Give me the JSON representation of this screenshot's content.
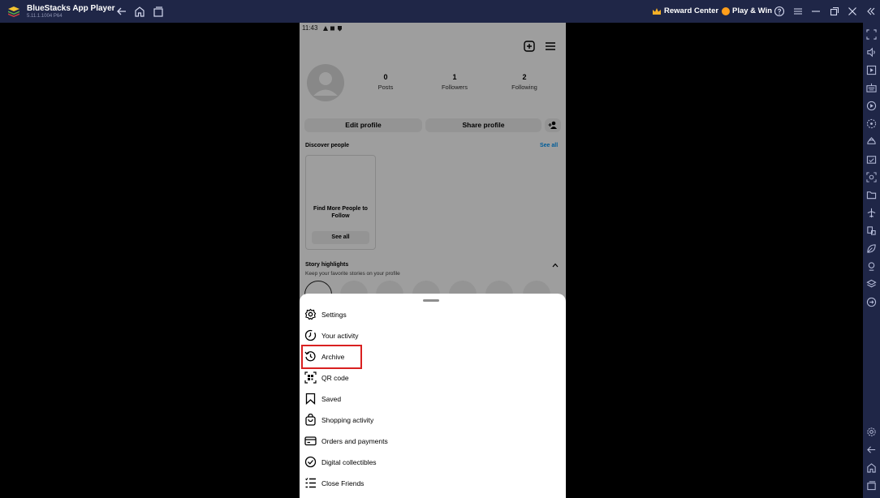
{
  "titlebar": {
    "app_name": "BlueStacks App Player",
    "app_version": "5.11.1.1004 P64",
    "reward_center": "Reward Center",
    "play_win": "Play & Win",
    "accent_color": "#1f2647"
  },
  "phone": {
    "status_time": "11:43",
    "profile": {
      "posts_count": "0",
      "posts_label": "Posts",
      "followers_count": "1",
      "followers_label": "Followers",
      "following_count": "2",
      "following_label": "Following",
      "edit_profile": "Edit profile",
      "share_profile": "Share profile"
    },
    "discover": {
      "title": "Discover people",
      "see_all": "See all",
      "card_text": "Find More People to Follow",
      "card_button": "See all"
    },
    "highlights": {
      "title": "Story highlights",
      "subtitle": "Keep your favorite stories on your profile"
    }
  },
  "menu": {
    "items": [
      {
        "label": "Settings",
        "icon": "settings-icon"
      },
      {
        "label": "Your activity",
        "icon": "activity-icon"
      },
      {
        "label": "Archive",
        "icon": "archive-icon"
      },
      {
        "label": "QR code",
        "icon": "qr-code-icon"
      },
      {
        "label": "Saved",
        "icon": "bookmark-icon"
      },
      {
        "label": "Shopping activity",
        "icon": "shopping-bag-icon"
      },
      {
        "label": "Orders and payments",
        "icon": "credit-card-icon"
      },
      {
        "label": "Digital collectibles",
        "icon": "verified-check-icon"
      },
      {
        "label": "Close Friends",
        "icon": "close-friends-list-icon"
      }
    ],
    "highlight_color": "#d92121"
  }
}
